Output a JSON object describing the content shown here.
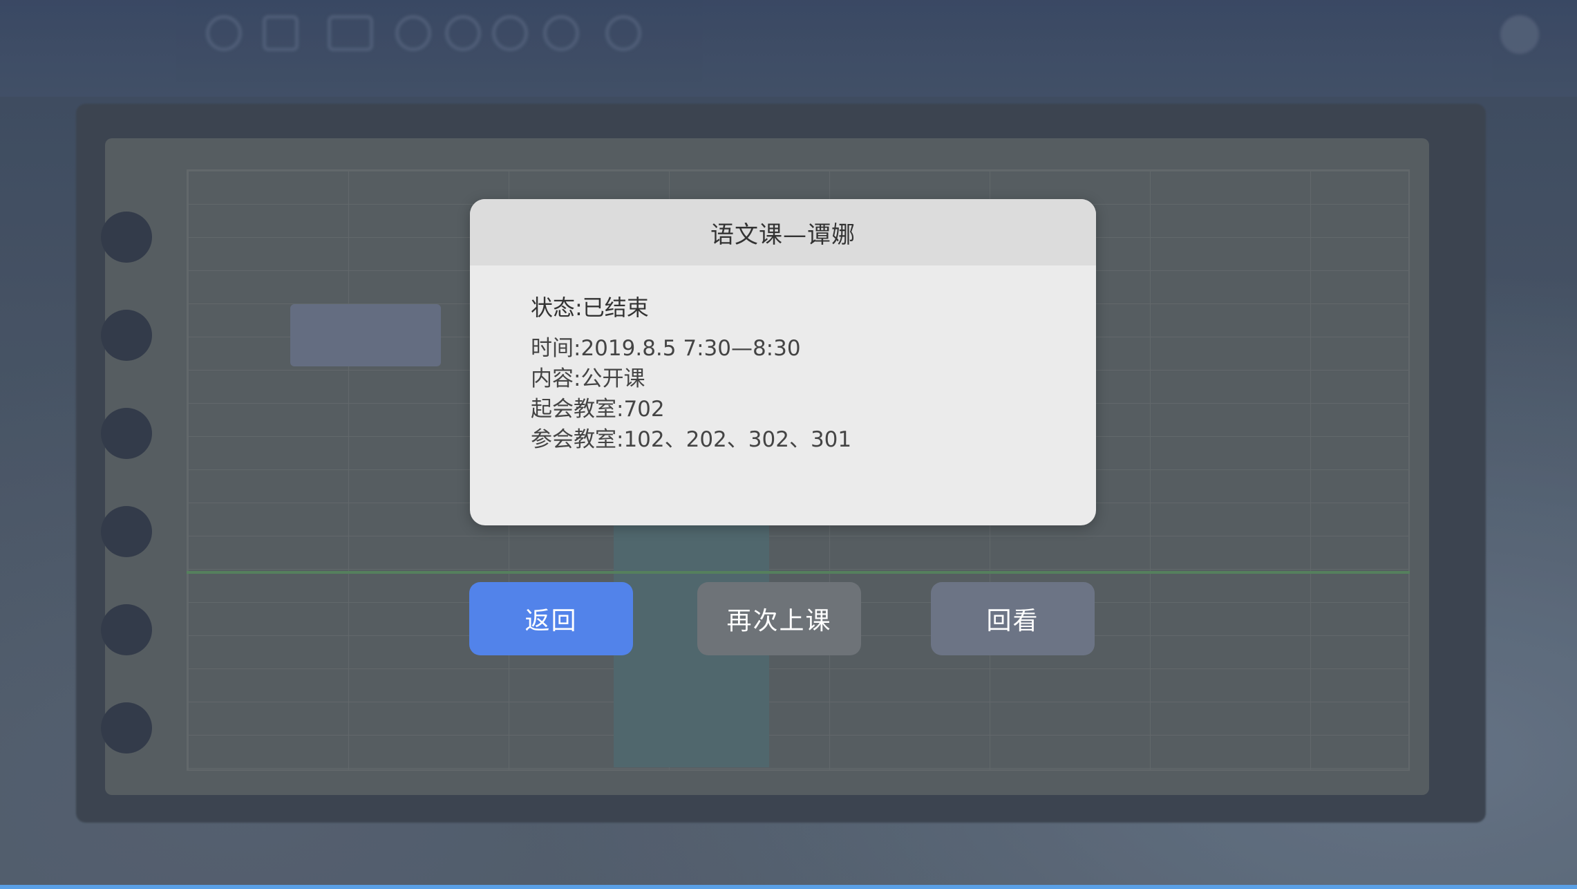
{
  "dialog": {
    "title": "语文课—谭娜",
    "status": "状态:已结束",
    "lines": [
      "时间:2019.8.5  7:30—8:30",
      "内容:公开课",
      "起会教室:702",
      "参会教室:102、202、302、301"
    ]
  },
  "buttons": {
    "back": "返回",
    "again": "再次上课",
    "replay": "回看"
  },
  "colors": {
    "primary_button": "#5283ea",
    "secondary_button": "#6e7378"
  }
}
